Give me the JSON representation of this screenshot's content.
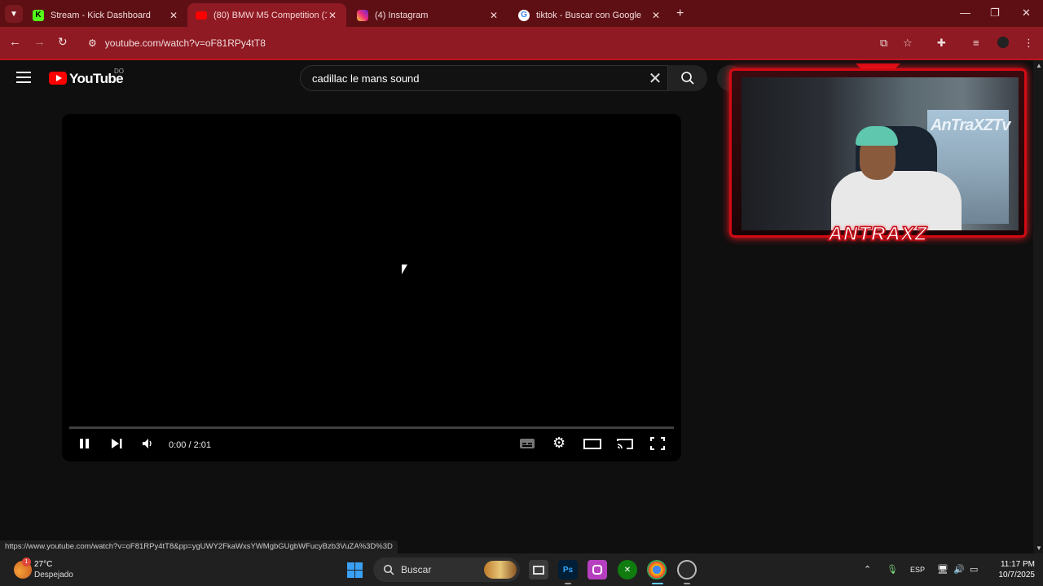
{
  "browser": {
    "tabs": [
      {
        "label": "Stream - Kick Dashboard",
        "favicon": "kick-icon",
        "active": false
      },
      {
        "label": "(80) BMW M5 Competition (12(",
        "favicon": "youtube-icon",
        "active": true
      },
      {
        "label": "(4) Instagram",
        "favicon": "instagram-icon",
        "active": false
      },
      {
        "label": "tiktok - Buscar con Google",
        "favicon": "google-icon",
        "active": false
      }
    ],
    "url": "youtube.com/watch?v=oF81RPy4tT8",
    "status_url": "https://www.youtube.com/watch?v=oF81RPy4tT8&pp=ygUWY2FkaWxsYWMgbGUgbWFucyBzb3VuZA%3D%3D"
  },
  "youtube": {
    "logo_text": "YouTube",
    "region": "DO",
    "search_value": "cadillac le mans sound"
  },
  "player": {
    "time": "0:00 / 2:01",
    "progress": 0
  },
  "overlay": {
    "nameplate": "ANTRAXZ",
    "channel_sign": "AnTraXZTv"
  },
  "taskbar": {
    "weather_temp": "27°C",
    "weather_desc": "Despejado",
    "weather_badge": "1",
    "search_label": "Buscar",
    "language": "ESP",
    "time": "11:17 PM",
    "date": "10/7/2025"
  },
  "colors": {
    "tab_bar": "#5e0f14",
    "toolbar": "#8f1a23",
    "youtube_red": "#ff0000",
    "overlay_red": "#d10a13"
  }
}
